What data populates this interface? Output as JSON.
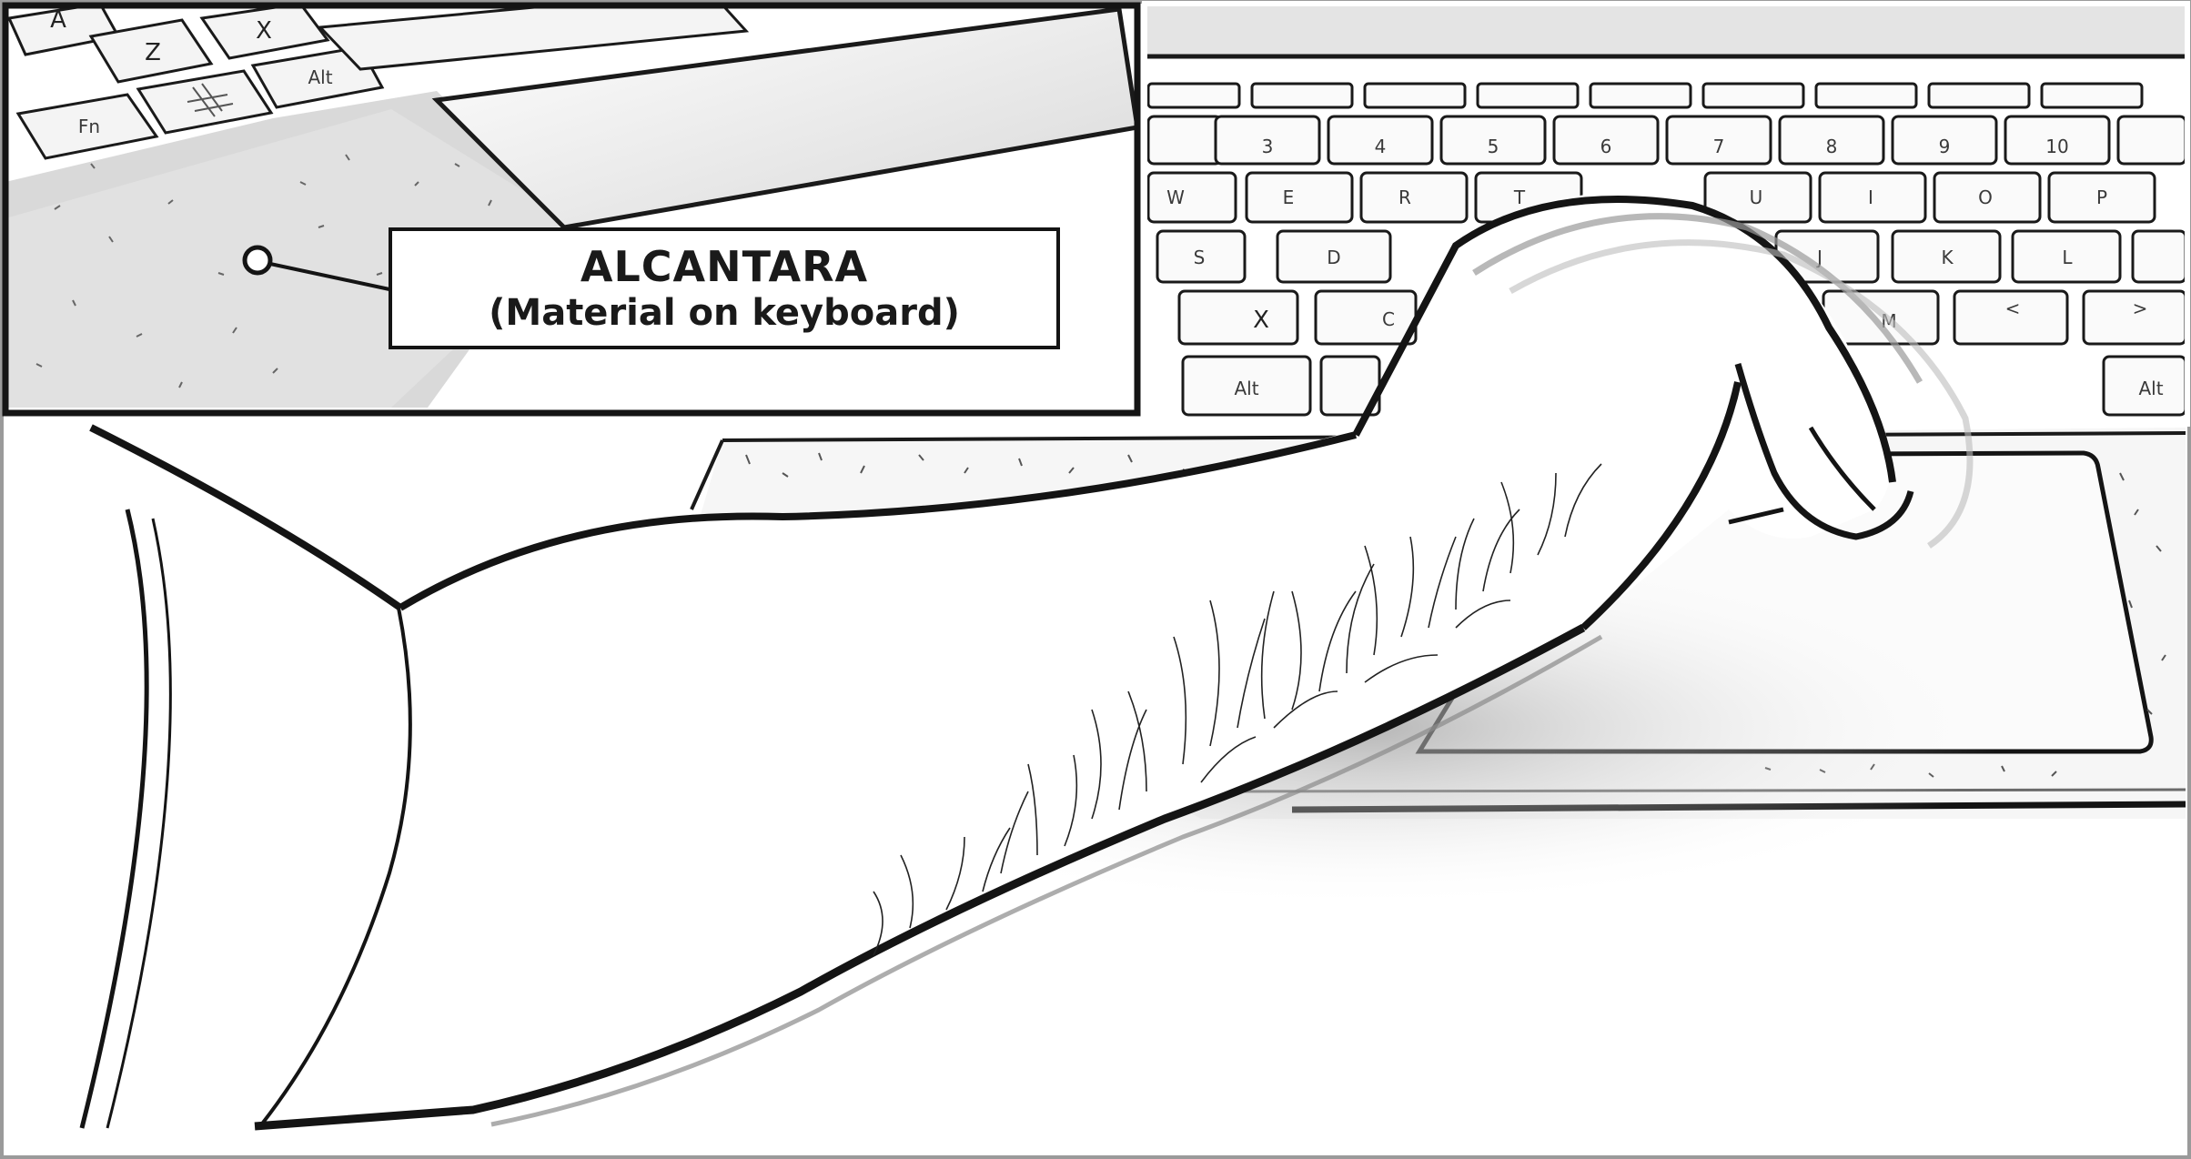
{
  "panel_inset": {
    "keys": {
      "a": "A",
      "z": "Z",
      "x": "X",
      "fn": "Fn",
      "alt": "Alt"
    },
    "callout": {
      "title": "ALCANTARA",
      "subtitle": "(Material on keyboard)"
    }
  },
  "panel_keyboard": {
    "number_row": [
      "3",
      "4",
      "5",
      "6",
      "7",
      "8",
      "9",
      "10"
    ],
    "top_row": [
      "W",
      "E",
      "R",
      "T",
      "U",
      "I",
      "O",
      "P"
    ],
    "home_row": [
      "S",
      "D",
      "J",
      "K",
      "L"
    ],
    "bottom_row": [
      "X",
      "C",
      "M",
      "<",
      ">"
    ],
    "alt_left": "Alt",
    "alt_right": "Alt"
  },
  "colors": {
    "ink": "#141414",
    "paper": "#ffffff",
    "fabric": "#c9c9c9"
  }
}
